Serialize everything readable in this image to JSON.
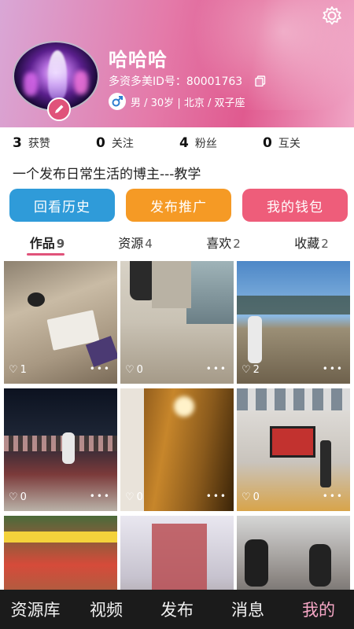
{
  "profile": {
    "username": "哈哈哈",
    "id_label": "多资多美ID号：",
    "id_value": "80001763",
    "info": "男 / 30岁 | 北京 / 双子座",
    "bio": "一个发布日常生活的博主---教学"
  },
  "stats": [
    {
      "num": "3",
      "label": "获赞"
    },
    {
      "num": "0",
      "label": "关注"
    },
    {
      "num": "4",
      "label": "粉丝"
    },
    {
      "num": "0",
      "label": "互关"
    }
  ],
  "buttons": {
    "history": "回看历史",
    "promote": "发布推广",
    "wallet": "我的钱包"
  },
  "tabs": [
    {
      "label": "作品",
      "count": "9"
    },
    {
      "label": "资源",
      "count": "4"
    },
    {
      "label": "喜欢",
      "count": "2"
    },
    {
      "label": "收藏",
      "count": "2"
    }
  ],
  "posts": [
    {
      "likes": "1"
    },
    {
      "likes": "0"
    },
    {
      "likes": "2"
    },
    {
      "likes": "0"
    },
    {
      "likes": "0"
    },
    {
      "likes": "0"
    }
  ],
  "more_glyph": "•••",
  "nav": [
    "资源库",
    "视频",
    "发布",
    "消息",
    "我的"
  ],
  "colors": {
    "history_btn": "#2f9bd9",
    "promote_btn": "#f59a25",
    "wallet_btn": "#ee5d7a",
    "accent": "#e0527a",
    "nav_active": "#f7a7c6"
  }
}
